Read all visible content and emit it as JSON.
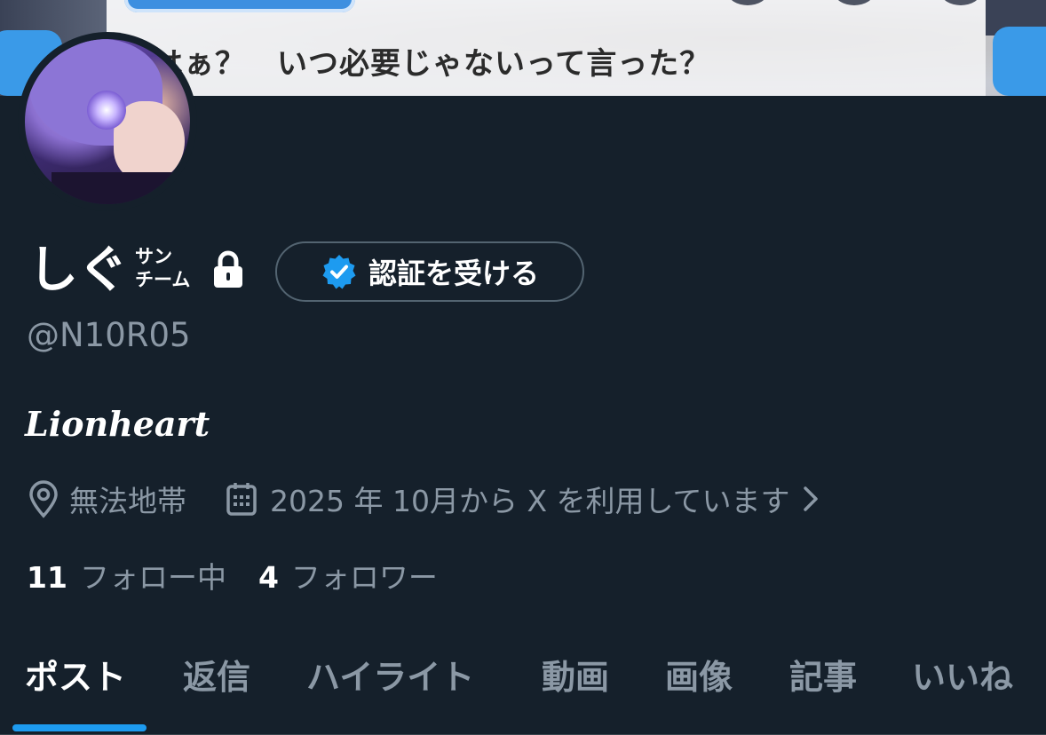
{
  "banner": {
    "text": "はぁ？　いつ必要じゃないって言った？"
  },
  "profile": {
    "display_name": "しぐ",
    "name_ruby_top": "サン",
    "name_ruby_bottom": "チーム",
    "verify_button_label": "認証を受ける",
    "handle": "@N10R05",
    "bio": "Lionheart",
    "location": "無法地帯",
    "joined": "2025 年 10月から X を利用しています",
    "following_count": "11",
    "following_label": "フォロー中",
    "followers_count": "4",
    "followers_label": "フォロワー"
  },
  "icons": {
    "lock": "lock-icon",
    "verified": "verified-badge-icon",
    "location": "location-pin-icon",
    "calendar": "calendar-icon",
    "chevron": "chevron-right-icon"
  },
  "tabs": [
    {
      "label": "ポスト",
      "active": true
    },
    {
      "label": "返信",
      "active": false
    },
    {
      "label": "ハイライト",
      "active": false
    },
    {
      "label": "動画",
      "active": false
    },
    {
      "label": "画像",
      "active": false
    },
    {
      "label": "記事",
      "active": false
    },
    {
      "label": "いいね",
      "active": false
    }
  ],
  "colors": {
    "background": "#15202b",
    "secondary_text": "#8b98a5",
    "accent": "#1d9bf0",
    "border": "#536471"
  }
}
